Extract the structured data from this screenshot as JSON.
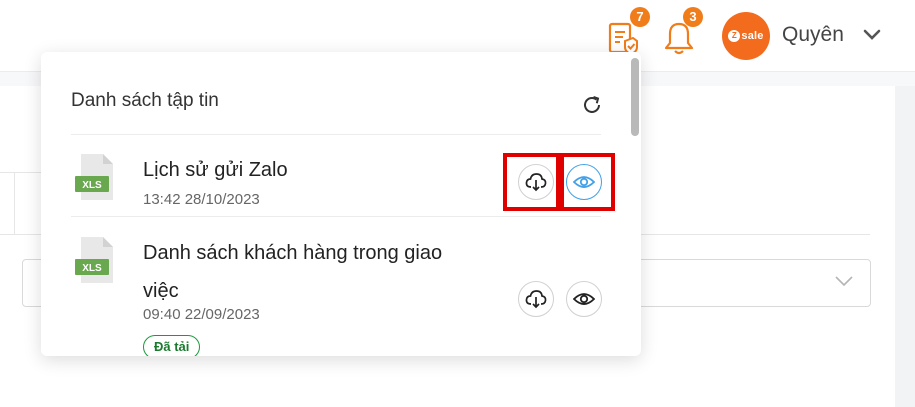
{
  "header": {
    "tasks_badge": "7",
    "notifications_badge": "3",
    "avatar_text": "sale",
    "avatar_z": "Z",
    "user_name": "Quyên"
  },
  "file_panel": {
    "title": "Danh sách tập tin",
    "files": [
      {
        "type": "XLS",
        "name": "Lịch sử gửi Zalo",
        "time": "13:42 28/10/2023",
        "status": ""
      },
      {
        "type": "XLS",
        "name": "Danh sách khách hàng trong giao việc",
        "time": "09:40 22/09/2023",
        "status": "Đã tải"
      }
    ]
  },
  "icons": {
    "tasks": "clipboard-check-icon",
    "notifications": "bell-icon",
    "user_menu": "chevron-down-icon",
    "refresh": "refresh-icon",
    "download": "cloud-download-icon",
    "view": "eye-icon",
    "file": "xls-file-icon"
  },
  "colors": {
    "accent_orange": "#f07c1a",
    "avatar_orange": "#f36b1c",
    "xls_green": "#6aa84f",
    "view_active_blue": "#42a1e8",
    "status_green": "#1a9a3a",
    "highlight_red": "#e00000"
  }
}
